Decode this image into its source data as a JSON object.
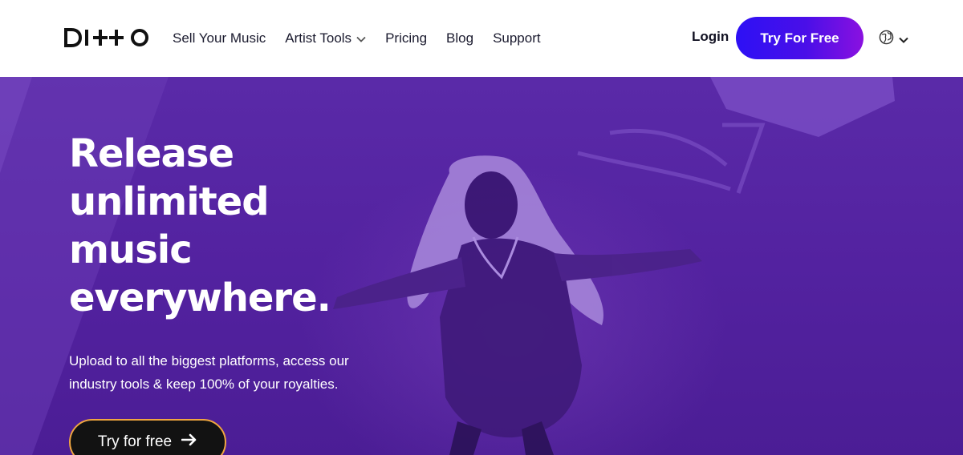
{
  "brand": {
    "name": "DITTO"
  },
  "nav": {
    "items": [
      {
        "label": "Sell Your Music",
        "has_dropdown": false
      },
      {
        "label": "Artist Tools",
        "has_dropdown": true
      },
      {
        "label": "Pricing",
        "has_dropdown": false
      },
      {
        "label": "Blog",
        "has_dropdown": false
      },
      {
        "label": "Support",
        "has_dropdown": false
      }
    ],
    "login_label": "Login",
    "cta_label": "Try For Free",
    "language_icon": "globe-icon"
  },
  "hero": {
    "title_lines": [
      "Release",
      "unlimited",
      "music",
      "everywhere."
    ],
    "subtitle_lines": [
      "Upload to all the biggest platforms, access our",
      "industry tools & keep 100% of your royalties."
    ],
    "cta_label": "Try for free",
    "cta_icon": "arrow-right-icon"
  },
  "colors": {
    "hero_overlay": "#5322a0",
    "cta_gradient_start": "#2d10f5",
    "cta_gradient_end": "#8a11e0",
    "hero_cta_border": "#f0a640",
    "hero_cta_bg": "#121212"
  }
}
